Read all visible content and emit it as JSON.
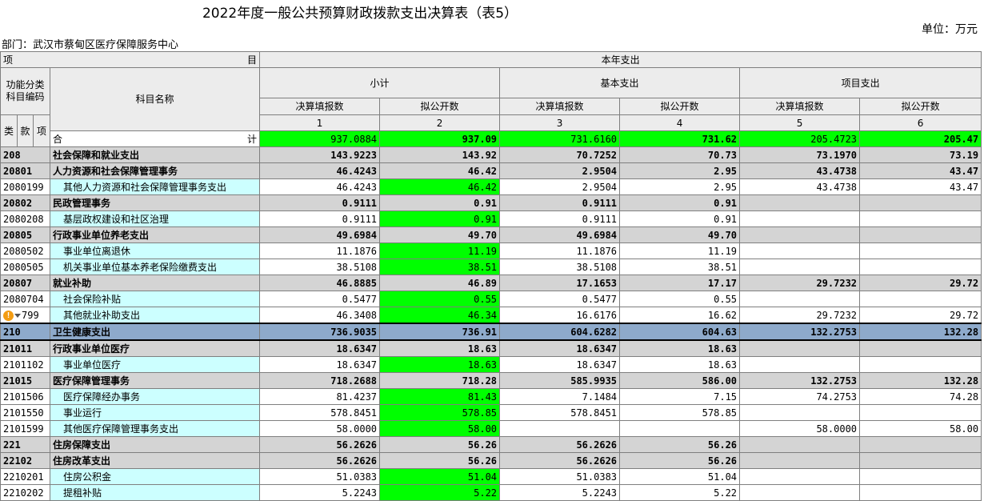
{
  "title": "2022年度一般公共预算财政拨款支出决算表（表5）",
  "unit": "单位：万元",
  "department": "部门：武汉市蔡甸区医疗保障服务中心",
  "header": {
    "xiang": "项",
    "mu": "目",
    "benian": "本年支出",
    "gnfl": "功能分类",
    "kmbm": "科目编码",
    "kmmc": "科目名称",
    "xiaoji": "小计",
    "jiben": "基本支出",
    "xiangmu": "项目支出",
    "jstb": "决算填报数",
    "ngk": "拟公开数",
    "lei": "类",
    "kuan": "款",
    "xiang2": "项",
    "lanci": "栏次",
    "cols": [
      "1",
      "2",
      "3",
      "4",
      "5",
      "6"
    ]
  },
  "total": {
    "label_left": "合",
    "label_right": "计",
    "values": [
      "937.0884",
      "937.09",
      "731.6160",
      "731.62",
      "205.4723",
      "205.47"
    ]
  },
  "warning_code": "799",
  "rows": [
    {
      "type": "bold",
      "code": "208",
      "name": "社会保障和就业支出",
      "v": [
        "143.9223",
        "143.92",
        "70.7252",
        "70.73",
        "73.1970",
        "73.19"
      ]
    },
    {
      "type": "bold",
      "code": "20801",
      "name": "人力资源和社会保障管理事务",
      "v": [
        "46.4243",
        "46.42",
        "2.9504",
        "2.95",
        "43.4738",
        "43.47"
      ]
    },
    {
      "type": "item",
      "code": "2080199",
      "name": "其他人力资源和社会保障管理事务支出",
      "v": [
        "46.4243",
        "46.42",
        "2.9504",
        "2.95",
        "43.4738",
        "43.47"
      ]
    },
    {
      "type": "bold",
      "code": "20802",
      "name": "民政管理事务",
      "v": [
        "0.9111",
        "0.91",
        "0.9111",
        "0.91",
        "",
        ""
      ]
    },
    {
      "type": "item",
      "code": "2080208",
      "name": "基层政权建设和社区治理",
      "v": [
        "0.9111",
        "0.91",
        "0.9111",
        "0.91",
        "",
        ""
      ]
    },
    {
      "type": "bold",
      "code": "20805",
      "name": "行政事业单位养老支出",
      "v": [
        "49.6984",
        "49.70",
        "49.6984",
        "49.70",
        "",
        ""
      ]
    },
    {
      "type": "item",
      "code": "2080502",
      "name": "事业单位离退休",
      "v": [
        "11.1876",
        "11.19",
        "11.1876",
        "11.19",
        "",
        ""
      ]
    },
    {
      "type": "item",
      "code": "2080505",
      "name": "机关事业单位基本养老保险缴费支出",
      "v": [
        "38.5108",
        "38.51",
        "38.5108",
        "38.51",
        "",
        ""
      ]
    },
    {
      "type": "bold",
      "code": "20807",
      "name": "就业补助",
      "v": [
        "46.8885",
        "46.89",
        "17.1653",
        "17.17",
        "29.7232",
        "29.72"
      ]
    },
    {
      "type": "item",
      "code": "2080704",
      "name": "社会保险补贴",
      "v": [
        "0.5477",
        "0.55",
        "0.5477",
        "0.55",
        "",
        ""
      ]
    },
    {
      "type": "item",
      "code": "warn",
      "name": "其他就业补助支出",
      "v": [
        "46.3408",
        "46.34",
        "16.6176",
        "16.62",
        "29.7232",
        "29.72"
      ]
    },
    {
      "type": "sel",
      "code": "210",
      "name": "卫生健康支出",
      "v": [
        "736.9035",
        "736.91",
        "604.6282",
        "604.63",
        "132.2753",
        "132.28"
      ]
    },
    {
      "type": "bold",
      "code": "21011",
      "name": "行政事业单位医疗",
      "v": [
        "18.6347",
        "18.63",
        "18.6347",
        "18.63",
        "",
        ""
      ]
    },
    {
      "type": "item",
      "code": "2101102",
      "name": "事业单位医疗",
      "v": [
        "18.6347",
        "18.63",
        "18.6347",
        "18.63",
        "",
        ""
      ]
    },
    {
      "type": "bold",
      "code": "21015",
      "name": "医疗保障管理事务",
      "v": [
        "718.2688",
        "718.28",
        "585.9935",
        "586.00",
        "132.2753",
        "132.28"
      ]
    },
    {
      "type": "item",
      "code": "2101506",
      "name": "医疗保障经办事务",
      "v": [
        "81.4237",
        "81.43",
        "7.1484",
        "7.15",
        "74.2753",
        "74.28"
      ]
    },
    {
      "type": "item",
      "code": "2101550",
      "name": "事业运行",
      "v": [
        "578.8451",
        "578.85",
        "578.8451",
        "578.85",
        "",
        ""
      ]
    },
    {
      "type": "item",
      "code": "2101599",
      "name": "其他医疗保障管理事务支出",
      "v": [
        "58.0000",
        "58.00",
        "",
        "",
        "58.0000",
        "58.00"
      ]
    },
    {
      "type": "bold",
      "code": "221",
      "name": "住房保障支出",
      "v": [
        "56.2626",
        "56.26",
        "56.2626",
        "56.26",
        "",
        ""
      ]
    },
    {
      "type": "bold",
      "code": "22102",
      "name": "住房改革支出",
      "v": [
        "56.2626",
        "56.26",
        "56.2626",
        "56.26",
        "",
        ""
      ]
    },
    {
      "type": "item",
      "code": "2210201",
      "name": "住房公积金",
      "v": [
        "51.0383",
        "51.04",
        "51.0383",
        "51.04",
        "",
        ""
      ]
    },
    {
      "type": "item",
      "code": "2210202",
      "name": "提租补贴",
      "v": [
        "5.2243",
        "5.22",
        "5.2243",
        "5.22",
        "",
        ""
      ]
    }
  ]
}
